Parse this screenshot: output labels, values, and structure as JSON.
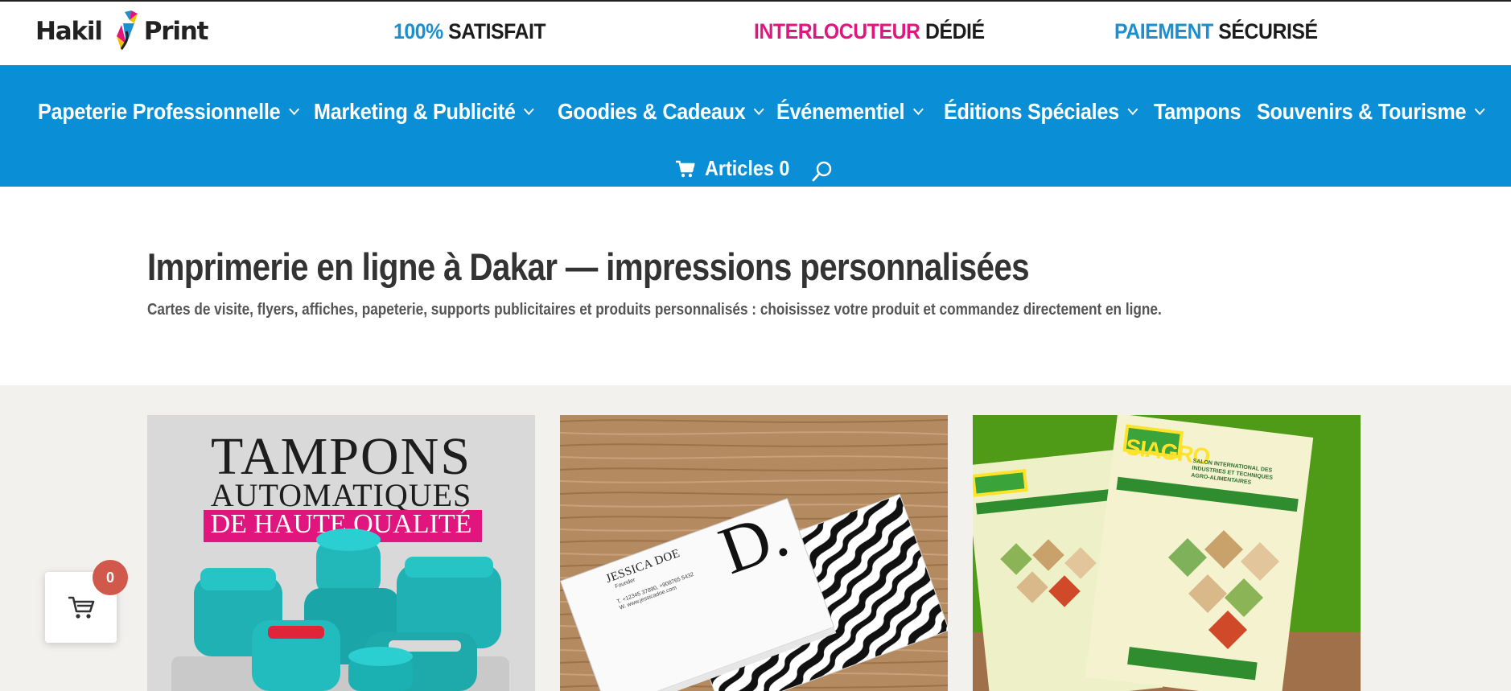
{
  "brand": {
    "name_left": "Hakil",
    "name_right": "Print"
  },
  "usps": [
    {
      "highlight": "100%",
      "rest": "SATISFAIT",
      "color": "#1a8fd1"
    },
    {
      "highlight": "INTERLOCUTEUR",
      "rest": "DÉDIÉ",
      "color": "#e0157e"
    },
    {
      "highlight": "PAIEMENT",
      "rest": "SÉCURISÉ",
      "color": "#1a8fd1"
    }
  ],
  "nav": {
    "items": [
      {
        "label": "Papeterie Professionnelle",
        "has_dropdown": true
      },
      {
        "label": "Marketing & Publicité",
        "has_dropdown": true
      },
      {
        "label": "Goodies & Cadeaux",
        "has_dropdown": true
      },
      {
        "label": "Événementiel",
        "has_dropdown": true
      },
      {
        "label": "Éditions Spéciales",
        "has_dropdown": true
      },
      {
        "label": "Tampons",
        "has_dropdown": false
      },
      {
        "label": "Souvenirs & Tourisme",
        "has_dropdown": true
      }
    ],
    "cart_label": "Articles 0",
    "cart_icon": "shopping-cart-icon",
    "search_icon": "search-icon",
    "background": "#0a8fd6"
  },
  "hero": {
    "title": "Imprimerie en ligne à Dakar — impressions personnalisées",
    "subtitle": "Cartes de visite, flyers, affiches, papeterie, supports publicitaires et produits personnalisés : choisissez votre produit et commandez directement en ligne."
  },
  "products": [
    {
      "name": "tampons-card",
      "image_text": {
        "line1": "TAMPONS",
        "line2": "AUTOMATIQUES",
        "line3": "DE HAUTE QUALITÉ"
      }
    },
    {
      "name": "business-cards-card",
      "image_text": {
        "card_name": "JESSICA DOE",
        "card_role": "Founder",
        "card_phone": "T. +12345 37890, +908765 5432",
        "card_web": "W. www.jessicadoe.com",
        "monogram": "D."
      }
    },
    {
      "name": "flyers-card",
      "image_text": {
        "brand": "SIAGRO",
        "headline": "SALON INTERNATIONAL DES INDUSTRIES ET TECHNIQUES AGRO-ALIMENTAIRES"
      }
    }
  ],
  "floating_cart": {
    "count": "0",
    "icon": "shopping-cart-icon",
    "badge_color": "#d1594b"
  }
}
